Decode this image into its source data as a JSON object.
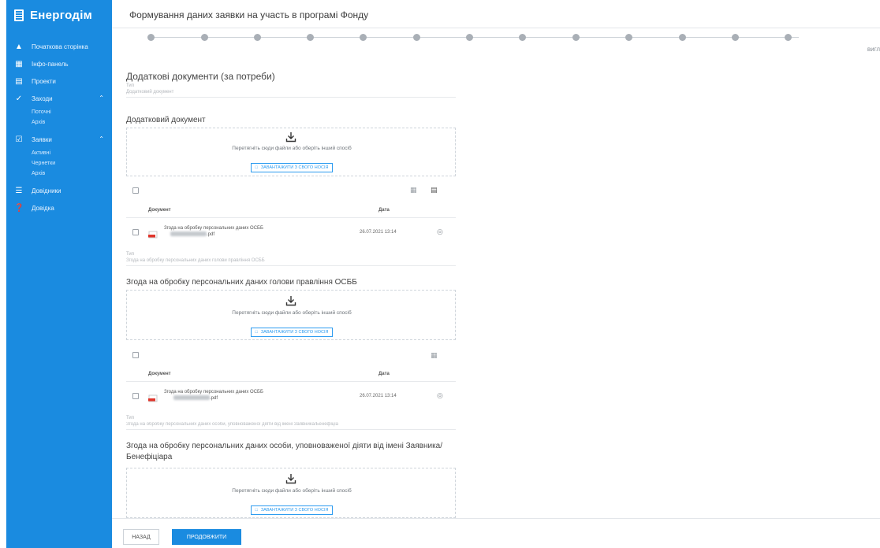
{
  "app": {
    "brand": "Енергодім",
    "brand_icon": "building-icon",
    "accent": "#1a8be0"
  },
  "sidebar": {
    "items": [
      {
        "label": "Початкова сторінка",
        "icon": "home-icon"
      },
      {
        "label": "Інфо-панель",
        "icon": "dashboard-icon"
      },
      {
        "label": "Проекти",
        "icon": "projects-icon"
      },
      {
        "label": "Заходи",
        "icon": "check-icon",
        "expanded": true,
        "children": [
          "Поточні",
          "Архів"
        ]
      },
      {
        "label": "Заявки",
        "icon": "checkbox-icon",
        "expanded": true,
        "children": [
          "Активні",
          "Чернетки",
          "Архів"
        ]
      },
      {
        "label": "Довідники",
        "icon": "list-icon"
      },
      {
        "label": "Довідка",
        "icon": "help-icon"
      }
    ]
  },
  "header": {
    "title": "Формування даних заявки на участь в програмі Фонду"
  },
  "stepper": {
    "count": 13
  },
  "side_note": "вигл",
  "content": {
    "section_title": "Додаткові документи (за потреби)",
    "type_label": "Тип",
    "type_value_1": "Додатковий документ",
    "doc1_title": "Додатковий документ",
    "dropzone_text": "Перетягніть сюди файли або оберіть інший спосіб",
    "dropzone_button": "ЗАВАНТАЖИТИ З СВОГО НОСІЯ",
    "col_document": "Документ",
    "col_date": "Дата",
    "file1_name": "Згода на обробку персональних даних ОСББ",
    "file1_ext": ".pdf",
    "file1_date": "26.07.2021 13:14",
    "type_value_2": "Згода на обробку персональних даних голови правління ОСББ",
    "doc2_title": "Згода на обробку персональних даних голови правління ОСББ",
    "file2_name": "Згода на обробку персональних даних ОСББ",
    "file2_ext": ".pdf",
    "file2_date": "26.07.2021 13:14",
    "type_value_3": "Згода на обробку персональних даних особи, уповноваженої діяти від імені Заявника/Бенефіціа",
    "doc3_title": "Згода на обробку персональних даних особи, уповноваженої діяти від імені Заявника/Бенефіціара"
  },
  "footer": {
    "back_label": "НАЗАД",
    "next_label": "ПРОДОВЖИТИ"
  }
}
